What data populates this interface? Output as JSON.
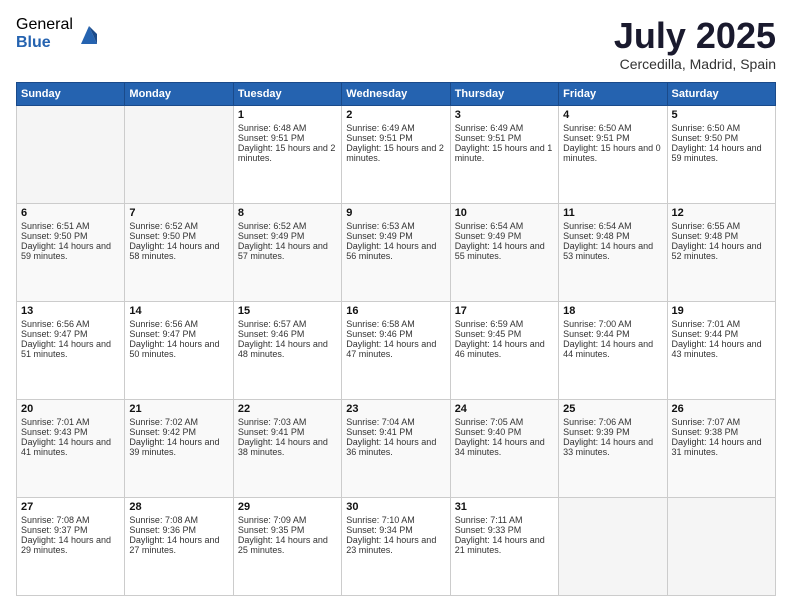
{
  "logo": {
    "general": "General",
    "blue": "Blue"
  },
  "title": "July 2025",
  "subtitle": "Cercedilla, Madrid, Spain",
  "header_days": [
    "Sunday",
    "Monday",
    "Tuesday",
    "Wednesday",
    "Thursday",
    "Friday",
    "Saturday"
  ],
  "weeks": [
    {
      "days": [
        {
          "num": "",
          "sunrise": "",
          "sunset": "",
          "daylight": "",
          "empty": true
        },
        {
          "num": "",
          "sunrise": "",
          "sunset": "",
          "daylight": "",
          "empty": true
        },
        {
          "num": "1",
          "sunrise": "Sunrise: 6:48 AM",
          "sunset": "Sunset: 9:51 PM",
          "daylight": "Daylight: 15 hours and 2 minutes."
        },
        {
          "num": "2",
          "sunrise": "Sunrise: 6:49 AM",
          "sunset": "Sunset: 9:51 PM",
          "daylight": "Daylight: 15 hours and 2 minutes."
        },
        {
          "num": "3",
          "sunrise": "Sunrise: 6:49 AM",
          "sunset": "Sunset: 9:51 PM",
          "daylight": "Daylight: 15 hours and 1 minute."
        },
        {
          "num": "4",
          "sunrise": "Sunrise: 6:50 AM",
          "sunset": "Sunset: 9:51 PM",
          "daylight": "Daylight: 15 hours and 0 minutes."
        },
        {
          "num": "5",
          "sunrise": "Sunrise: 6:50 AM",
          "sunset": "Sunset: 9:50 PM",
          "daylight": "Daylight: 14 hours and 59 minutes."
        }
      ]
    },
    {
      "days": [
        {
          "num": "6",
          "sunrise": "Sunrise: 6:51 AM",
          "sunset": "Sunset: 9:50 PM",
          "daylight": "Daylight: 14 hours and 59 minutes."
        },
        {
          "num": "7",
          "sunrise": "Sunrise: 6:52 AM",
          "sunset": "Sunset: 9:50 PM",
          "daylight": "Daylight: 14 hours and 58 minutes."
        },
        {
          "num": "8",
          "sunrise": "Sunrise: 6:52 AM",
          "sunset": "Sunset: 9:49 PM",
          "daylight": "Daylight: 14 hours and 57 minutes."
        },
        {
          "num": "9",
          "sunrise": "Sunrise: 6:53 AM",
          "sunset": "Sunset: 9:49 PM",
          "daylight": "Daylight: 14 hours and 56 minutes."
        },
        {
          "num": "10",
          "sunrise": "Sunrise: 6:54 AM",
          "sunset": "Sunset: 9:49 PM",
          "daylight": "Daylight: 14 hours and 55 minutes."
        },
        {
          "num": "11",
          "sunrise": "Sunrise: 6:54 AM",
          "sunset": "Sunset: 9:48 PM",
          "daylight": "Daylight: 14 hours and 53 minutes."
        },
        {
          "num": "12",
          "sunrise": "Sunrise: 6:55 AM",
          "sunset": "Sunset: 9:48 PM",
          "daylight": "Daylight: 14 hours and 52 minutes."
        }
      ]
    },
    {
      "days": [
        {
          "num": "13",
          "sunrise": "Sunrise: 6:56 AM",
          "sunset": "Sunset: 9:47 PM",
          "daylight": "Daylight: 14 hours and 51 minutes."
        },
        {
          "num": "14",
          "sunrise": "Sunrise: 6:56 AM",
          "sunset": "Sunset: 9:47 PM",
          "daylight": "Daylight: 14 hours and 50 minutes."
        },
        {
          "num": "15",
          "sunrise": "Sunrise: 6:57 AM",
          "sunset": "Sunset: 9:46 PM",
          "daylight": "Daylight: 14 hours and 48 minutes."
        },
        {
          "num": "16",
          "sunrise": "Sunrise: 6:58 AM",
          "sunset": "Sunset: 9:46 PM",
          "daylight": "Daylight: 14 hours and 47 minutes."
        },
        {
          "num": "17",
          "sunrise": "Sunrise: 6:59 AM",
          "sunset": "Sunset: 9:45 PM",
          "daylight": "Daylight: 14 hours and 46 minutes."
        },
        {
          "num": "18",
          "sunrise": "Sunrise: 7:00 AM",
          "sunset": "Sunset: 9:44 PM",
          "daylight": "Daylight: 14 hours and 44 minutes."
        },
        {
          "num": "19",
          "sunrise": "Sunrise: 7:01 AM",
          "sunset": "Sunset: 9:44 PM",
          "daylight": "Daylight: 14 hours and 43 minutes."
        }
      ]
    },
    {
      "days": [
        {
          "num": "20",
          "sunrise": "Sunrise: 7:01 AM",
          "sunset": "Sunset: 9:43 PM",
          "daylight": "Daylight: 14 hours and 41 minutes."
        },
        {
          "num": "21",
          "sunrise": "Sunrise: 7:02 AM",
          "sunset": "Sunset: 9:42 PM",
          "daylight": "Daylight: 14 hours and 39 minutes."
        },
        {
          "num": "22",
          "sunrise": "Sunrise: 7:03 AM",
          "sunset": "Sunset: 9:41 PM",
          "daylight": "Daylight: 14 hours and 38 minutes."
        },
        {
          "num": "23",
          "sunrise": "Sunrise: 7:04 AM",
          "sunset": "Sunset: 9:41 PM",
          "daylight": "Daylight: 14 hours and 36 minutes."
        },
        {
          "num": "24",
          "sunrise": "Sunrise: 7:05 AM",
          "sunset": "Sunset: 9:40 PM",
          "daylight": "Daylight: 14 hours and 34 minutes."
        },
        {
          "num": "25",
          "sunrise": "Sunrise: 7:06 AM",
          "sunset": "Sunset: 9:39 PM",
          "daylight": "Daylight: 14 hours and 33 minutes."
        },
        {
          "num": "26",
          "sunrise": "Sunrise: 7:07 AM",
          "sunset": "Sunset: 9:38 PM",
          "daylight": "Daylight: 14 hours and 31 minutes."
        }
      ]
    },
    {
      "days": [
        {
          "num": "27",
          "sunrise": "Sunrise: 7:08 AM",
          "sunset": "Sunset: 9:37 PM",
          "daylight": "Daylight: 14 hours and 29 minutes."
        },
        {
          "num": "28",
          "sunrise": "Sunrise: 7:08 AM",
          "sunset": "Sunset: 9:36 PM",
          "daylight": "Daylight: 14 hours and 27 minutes."
        },
        {
          "num": "29",
          "sunrise": "Sunrise: 7:09 AM",
          "sunset": "Sunset: 9:35 PM",
          "daylight": "Daylight: 14 hours and 25 minutes."
        },
        {
          "num": "30",
          "sunrise": "Sunrise: 7:10 AM",
          "sunset": "Sunset: 9:34 PM",
          "daylight": "Daylight: 14 hours and 23 minutes."
        },
        {
          "num": "31",
          "sunrise": "Sunrise: 7:11 AM",
          "sunset": "Sunset: 9:33 PM",
          "daylight": "Daylight: 14 hours and 21 minutes."
        },
        {
          "num": "",
          "sunrise": "",
          "sunset": "",
          "daylight": "",
          "empty": true
        },
        {
          "num": "",
          "sunrise": "",
          "sunset": "",
          "daylight": "",
          "empty": true
        }
      ]
    }
  ]
}
